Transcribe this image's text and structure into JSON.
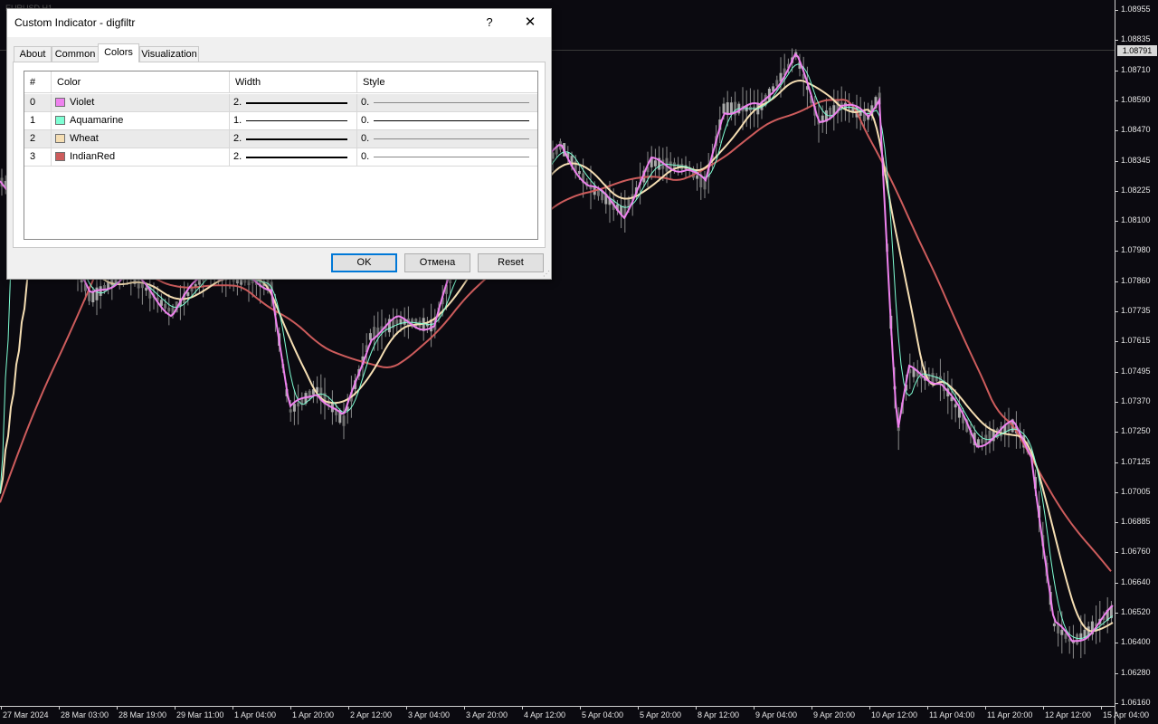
{
  "chart": {
    "symbol_tag": "EURUSD,H1",
    "current_price": "1.08791",
    "price_labels": [
      "1.08955",
      "1.08835",
      "1.08710",
      "1.08590",
      "1.08470",
      "1.08345",
      "1.08225",
      "1.08100",
      "1.07980",
      "1.07860",
      "1.07735",
      "1.07615",
      "1.07495",
      "1.07370",
      "1.07250",
      "1.07125",
      "1.07005",
      "1.06885",
      "1.06760",
      "1.06640",
      "1.06520",
      "1.06400",
      "1.06280",
      "1.06160"
    ],
    "time_labels": [
      "27 Mar 2024",
      "28 Mar 03:00",
      "28 Mar 19:00",
      "29 Mar 11:00",
      "1 Apr 04:00",
      "1 Apr 20:00",
      "2 Apr 12:00",
      "3 Apr 04:00",
      "3 Apr 20:00",
      "4 Apr 12:00",
      "5 Apr 04:00",
      "5 Apr 20:00",
      "8 Apr 12:00",
      "9 Apr 04:00",
      "9 Apr 20:00",
      "10 Apr 12:00",
      "11 Apr 04:00",
      "11 Apr 20:00",
      "12 Apr 12:00",
      "15 Apr 04:00"
    ],
    "line_colors": {
      "violet": "#ee82ee",
      "aquamarine": "#7fffd4",
      "wheat": "#f5deb3",
      "indianred": "#cd5c5c"
    }
  },
  "dialog": {
    "title": "Custom Indicator - digfiltr",
    "help_label": "?",
    "close_label": "✕",
    "tabs": [
      {
        "label": "About",
        "active": false
      },
      {
        "label": "Common",
        "active": false
      },
      {
        "label": "Colors",
        "active": true
      },
      {
        "label": "Visualization",
        "active": false
      }
    ],
    "grid": {
      "headers": [
        "#",
        "Color",
        "Width",
        "Style"
      ],
      "rows": [
        {
          "index": "0",
          "color_name": "Violet",
          "color": "#ee82ee",
          "width": "2.",
          "style": "0."
        },
        {
          "index": "1",
          "color_name": "Aquamarine",
          "color": "#7fffd4",
          "width": "1.",
          "style": "0."
        },
        {
          "index": "2",
          "color_name": "Wheat",
          "color": "#f5deb3",
          "width": "2.",
          "style": "0."
        },
        {
          "index": "3",
          "color_name": "IndianRed",
          "color": "#cd5c5c",
          "width": "2.",
          "style": "0."
        }
      ]
    },
    "buttons": {
      "ok": "OK",
      "cancel": "Отмена",
      "reset": "Reset"
    }
  }
}
